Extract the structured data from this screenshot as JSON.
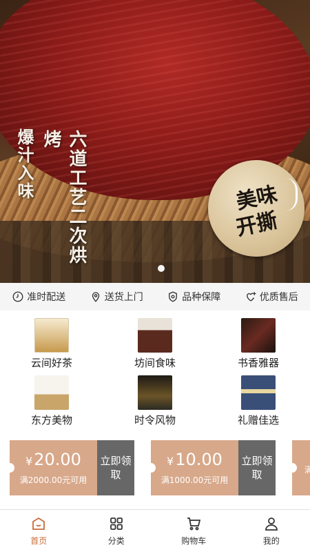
{
  "banner": {
    "vertical_text_1": "六道工艺二次烘烤",
    "vertical_text_2": "爆汁入味",
    "stamp_line1": "美味",
    "stamp_line2": "开撕",
    "carousel_index": 1
  },
  "services": [
    {
      "icon": "clock-icon",
      "label": "准时配送"
    },
    {
      "icon": "location-pin-icon",
      "label": "送货上门"
    },
    {
      "icon": "shield-icon",
      "label": "品种保障"
    },
    {
      "icon": "heart-plus-icon",
      "label": "优质售后"
    }
  ],
  "categories": [
    {
      "label": "云间好茶"
    },
    {
      "label": "坊间食味"
    },
    {
      "label": "书香雅器"
    },
    {
      "label": "东方美物"
    },
    {
      "label": "时令风物"
    },
    {
      "label": "礼赠佳选"
    }
  ],
  "coupons": [
    {
      "currency": "¥",
      "amount": "20.00",
      "condition": "满2000.00元可用",
      "claim": "立即领取"
    },
    {
      "currency": "¥",
      "amount": "10.00",
      "condition": "满1000.00元可用",
      "claim": "立即领取"
    },
    {
      "currency": "¥",
      "amount": "",
      "condition": "满",
      "claim": ""
    }
  ],
  "tabbar": [
    {
      "icon": "home-icon",
      "label": "首页",
      "active": true
    },
    {
      "icon": "grid-icon",
      "label": "分类",
      "active": false
    },
    {
      "icon": "cart-icon",
      "label": "购物车",
      "active": false
    },
    {
      "icon": "user-icon",
      "label": "我的",
      "active": false
    }
  ],
  "colors": {
    "accent": "#c86a3a",
    "coupon_main": "#d8a88a",
    "coupon_claim": "#676767"
  }
}
